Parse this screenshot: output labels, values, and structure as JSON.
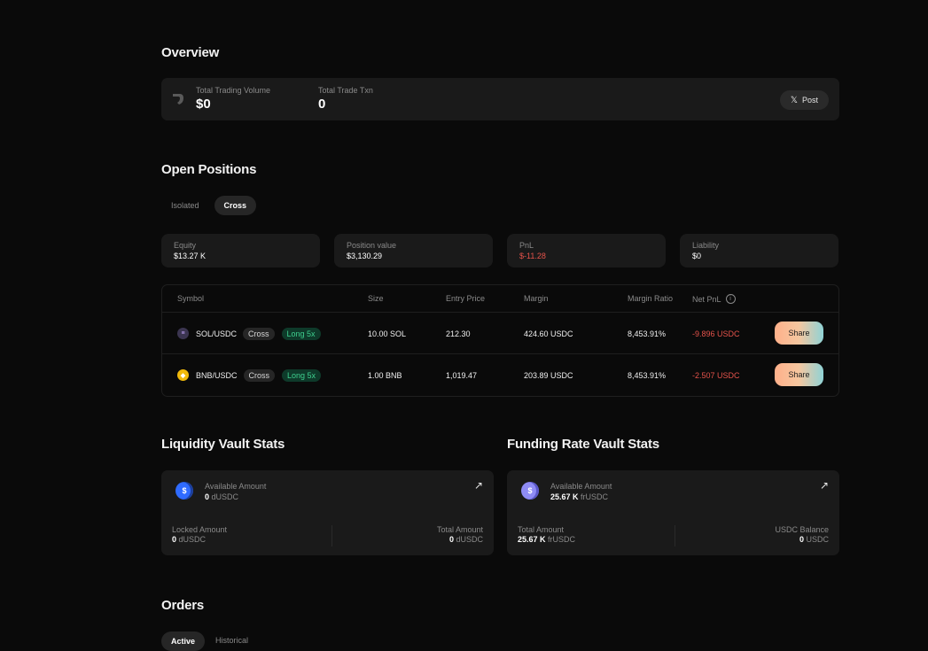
{
  "overview": {
    "title": "Overview",
    "total_volume_label": "Total Trading Volume",
    "total_volume_value": "$0",
    "total_txn_label": "Total Trade Txn",
    "total_txn_value": "0",
    "post_label": "Post",
    "post_icon": "x-icon"
  },
  "open_positions": {
    "title": "Open Positions",
    "tabs": [
      {
        "label": "Isolated",
        "active": false
      },
      {
        "label": "Cross",
        "active": true
      }
    ],
    "summary": [
      {
        "label": "Equity",
        "value": "$13.27 K"
      },
      {
        "label": "Position value",
        "value": "$3,130.29"
      },
      {
        "label": "PnL",
        "value": "$-11.28"
      },
      {
        "label": "Liability",
        "value": "$0"
      }
    ],
    "columns": [
      "Symbol",
      "Size",
      "Entry Price",
      "Margin",
      "Margin Ratio",
      "Net PnL"
    ],
    "rows": [
      {
        "symbol": "SOL/USDC",
        "mode": "Cross",
        "side": "Long 5x",
        "size": "10.00 SOL",
        "entry": "212.30",
        "margin": "424.60 USDC",
        "margin_ratio": "8,453.91%",
        "net_pnl": "-9.896 USDC",
        "action": "Share",
        "coin_icon": "solana-icon"
      },
      {
        "symbol": "BNB/USDC",
        "mode": "Cross",
        "side": "Long 5x",
        "size": "1.00 BNB",
        "entry": "1,019.47",
        "margin": "203.89 USDC",
        "margin_ratio": "8,453.91%",
        "net_pnl": "-2.507 USDC",
        "action": "Share",
        "coin_icon": "bnb-icon"
      }
    ]
  },
  "liquidity_vault": {
    "title": "Liquidity Vault Stats",
    "available_label": "Available Amount",
    "available_value": "0",
    "available_unit": "dUSDC",
    "locked_label": "Locked Amount",
    "locked_value": "0",
    "locked_unit": "dUSDC",
    "total_label": "Total Amount",
    "total_value": "0",
    "total_unit": "dUSDC"
  },
  "funding_vault": {
    "title": "Funding Rate Vault Stats",
    "available_label": "Available Amount",
    "available_value": "25.67 K",
    "available_unit": "frUSDC",
    "total_label": "Total Amount",
    "total_value": "25.67 K",
    "total_unit": "frUSDC",
    "balance_label": "USDC Balance",
    "balance_value": "0",
    "balance_unit": "USDC"
  },
  "orders": {
    "title": "Orders",
    "tabs": [
      {
        "label": "Active",
        "active": true
      },
      {
        "label": "Historical",
        "active": false
      }
    ]
  },
  "colors": {
    "background": "#0a0a0a",
    "card": "#1a1a1a",
    "negative": "#e5534b",
    "long_badge": "#3ecf8e"
  }
}
